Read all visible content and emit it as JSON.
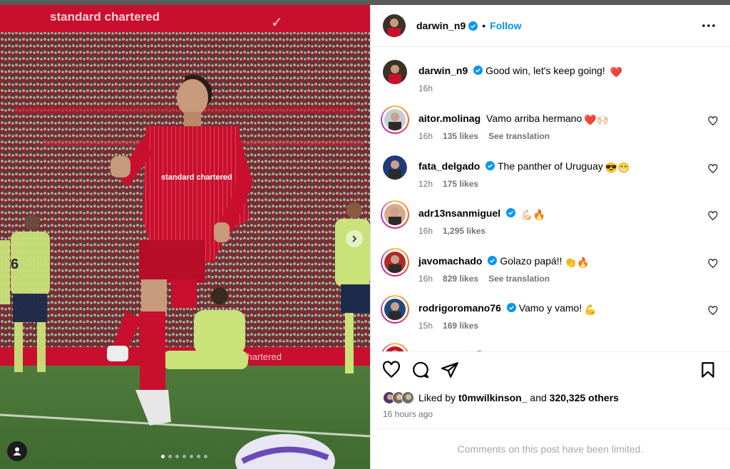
{
  "post": {
    "author": "darwin_n9",
    "follow_label": "Follow",
    "separator": "•",
    "caption_text": "Good win, let's keep going!",
    "caption_emoji": "❤️",
    "caption_time": "16h"
  },
  "media": {
    "banner_text": "standard chartered",
    "shirt_sponsor": "standard chartered",
    "ad_board": "chartered",
    "carousel_total": 7,
    "carousel_active": 0,
    "carousel_next_icon": "chevron-right-icon"
  },
  "comments": [
    {
      "username": "aitor.molinag",
      "verified": false,
      "text": "Vamo arriba hermano",
      "emoji": "❤️🙌🏻",
      "time": "16h",
      "likes": "135 likes",
      "see_translation": "See translation",
      "avatar_color": "#c8ccd2",
      "ring": true
    },
    {
      "username": "fata_delgado",
      "verified": true,
      "text": "The panther of Uruguay",
      "emoji": "😎😁",
      "time": "12h",
      "likes": "175 likes",
      "see_translation": "",
      "avatar_color": "#1f3b7a",
      "ring": false
    },
    {
      "username": "adr13nsanmiguel",
      "verified": true,
      "text": "",
      "emoji": "💪🏻🔥",
      "time": "16h",
      "likes": "1,295 likes",
      "see_translation": "",
      "avatar_color": "#d8a98f",
      "ring": true
    },
    {
      "username": "javomachado",
      "verified": true,
      "text": "Golazo papá!!",
      "emoji": "👏🔥",
      "time": "16h",
      "likes": "829 likes",
      "see_translation": "See translation",
      "avatar_color": "#b02a2a",
      "ring": true
    },
    {
      "username": "rodrigoromano76",
      "verified": true,
      "text": "Vamo y vamo!",
      "emoji": "💪",
      "time": "15h",
      "likes": "169 likes",
      "see_translation": "",
      "avatar_color": "#1e4a7a",
      "ring": true
    },
    {
      "username": "liverpoolfc",
      "verified": true,
      "text": "",
      "emoji": "🦁❤️",
      "time": "",
      "likes": "",
      "see_translation": "",
      "avatar_color": "#c8102e",
      "ring": true
    }
  ],
  "actions": {
    "like_icon": "heart-icon",
    "comment_icon": "comment-icon",
    "share_icon": "share-icon",
    "save_icon": "bookmark-icon"
  },
  "likes_summary": {
    "prefix": "Liked by",
    "user": "t0mwilkinson_",
    "joiner": "and",
    "others": "320,325 others"
  },
  "timestamp": "16 hours ago",
  "comments_limited": "Comments on this post have been limited.",
  "colors": {
    "accent": "#0095f6",
    "muted": "#737373",
    "verified": "#0095f6",
    "jersey": "#c8102e"
  }
}
